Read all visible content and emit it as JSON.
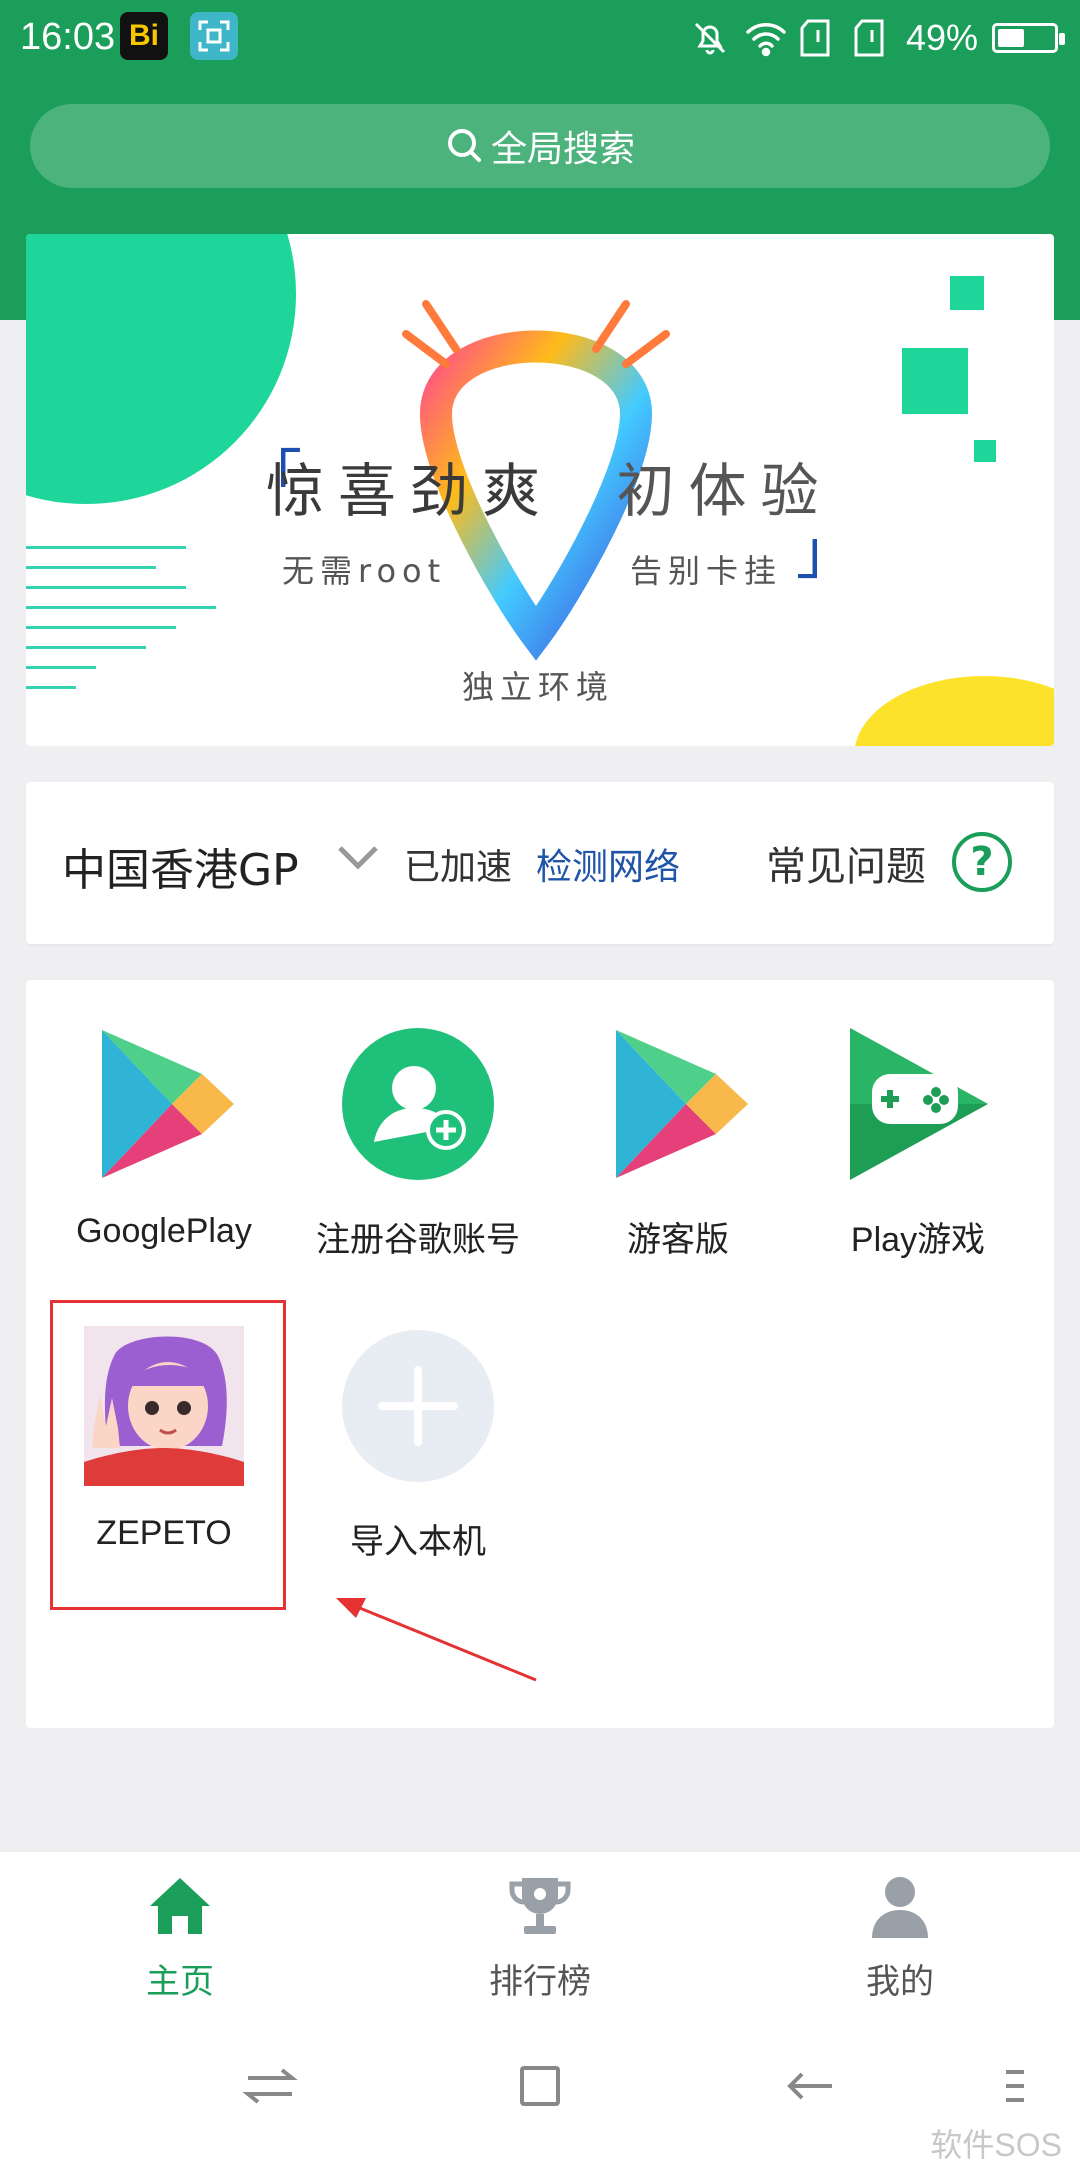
{
  "status_bar": {
    "time": "16:03",
    "bi_app_label": "Bi",
    "battery_text": "49%",
    "battery_level": 0.49,
    "icons": [
      "bi-app-icon",
      "screenshot-icon",
      "mute-bell-icon",
      "wifi-icon",
      "sim1-icon",
      "sim2-icon",
      "battery-icon"
    ]
  },
  "search": {
    "placeholder": "全局搜索"
  },
  "banner": {
    "title_part1": "惊喜劲爽",
    "title_part2": "初体验",
    "sub_left": "无需root",
    "sub_right": "告别卡挂",
    "sub_bottom": "独立环境"
  },
  "network": {
    "region": "中国香港GP",
    "accel_status": "已加速",
    "detect_link": "检测网络",
    "faq_link": "常见问题",
    "faq_icon": "?"
  },
  "apps": [
    {
      "label": "GooglePlay",
      "icon": "google-play-icon"
    },
    {
      "label": "注册谷歌账号",
      "icon": "add-account-icon"
    },
    {
      "label": "游客版",
      "icon": "google-play-icon"
    },
    {
      "label": "Play游戏",
      "icon": "play-games-icon"
    },
    {
      "label": "ZEPETO",
      "icon": "zepeto-avatar-icon"
    },
    {
      "label": "导入本机",
      "icon": "add-plus-icon"
    }
  ],
  "bottom_nav": [
    {
      "label": "主页",
      "icon": "home-icon",
      "active": true
    },
    {
      "label": "排行榜",
      "icon": "trophy-icon",
      "active": false
    },
    {
      "label": "我的",
      "icon": "person-icon",
      "active": false
    }
  ],
  "watermark": "软件SOS",
  "colors": {
    "brand_green": "#1a9e59",
    "link_blue": "#1f54a8",
    "highlight_red": "#e53232"
  }
}
